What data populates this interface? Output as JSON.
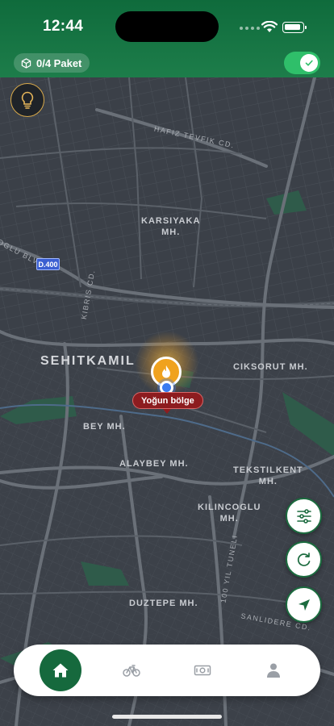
{
  "status_bar": {
    "time": "12:44"
  },
  "header": {
    "package_counter": "0/4 Paket",
    "online_toggle": "on"
  },
  "map": {
    "districts": [
      {
        "id": "karsiyaka",
        "label": "KARSIYAKA\nMH."
      },
      {
        "id": "sehitkamil",
        "label": "SEHITKAMIL"
      },
      {
        "id": "ciksorut",
        "label": "CIKSORUT MH."
      },
      {
        "id": "bey",
        "label": "BEY MH."
      },
      {
        "id": "alaybey",
        "label": "ALAYBEY MH."
      },
      {
        "id": "tekstilkent",
        "label": "TEKSTILKENT\nMH."
      },
      {
        "id": "kilincoglu",
        "label": "KILINCOGLU\nMH."
      },
      {
        "id": "duztepe",
        "label": "DUZTEPE MH."
      }
    ],
    "roads": [
      {
        "id": "hafiz",
        "label": "HAFIZ TEVFIK CD."
      },
      {
        "id": "oglu",
        "label": "OGLU BLV."
      },
      {
        "id": "kibris",
        "label": "KIBRIS CD."
      },
      {
        "id": "yil100",
        "label": "100 YIL TUNELI"
      },
      {
        "id": "sanlidere",
        "label": "SANLIDERE CD."
      }
    ],
    "highway_shield": "D.400",
    "busy_zone_label": "Yoğun bölge"
  },
  "map_controls": [
    "filters-icon",
    "refresh-icon",
    "navigate-icon"
  ],
  "bottom_nav": {
    "items": [
      {
        "icon": "home-icon",
        "active": true
      },
      {
        "icon": "bicycle-icon",
        "active": false
      },
      {
        "icon": "cash-icon",
        "active": false
      },
      {
        "icon": "profile-icon",
        "active": false
      }
    ]
  },
  "colors": {
    "brand_green": "#16693d",
    "toggle_green": "#2fbf6a",
    "busy_zone_red": "#8d1c1f",
    "hotspot_orange": "#f0a21e",
    "location_blue": "#3a7bf0",
    "map_background": "#3b4048"
  }
}
